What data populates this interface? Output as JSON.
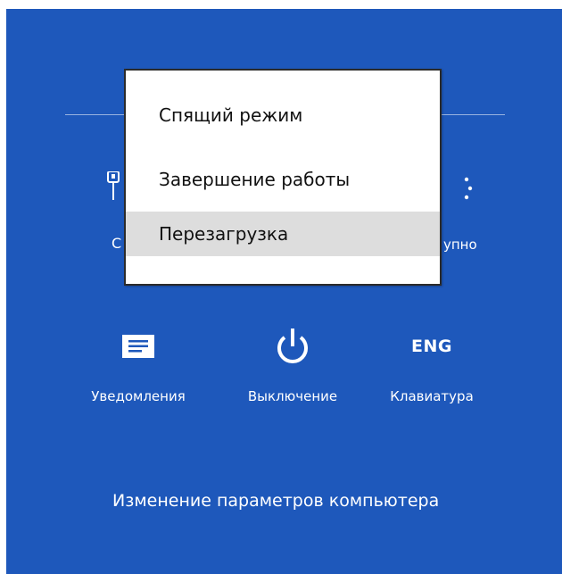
{
  "charms_panel": {
    "background_color": "#1e58bb",
    "hidden_left_label": "С",
    "hidden_left_icon": "network-icon",
    "hidden_right_label": "упно",
    "hidden_right_icon": "brightness-icon"
  },
  "power_menu": {
    "items": [
      {
        "label": "Спящий режим",
        "selected": false
      },
      {
        "label": "Завершение работы",
        "selected": false
      },
      {
        "label": "Перезагрузка",
        "selected": true
      }
    ],
    "selected_color": "#dddddd"
  },
  "tiles": [
    {
      "label": "Уведомления",
      "icon": "notifications-icon"
    },
    {
      "label": "Выключение",
      "icon": "power-icon"
    },
    {
      "label": "Клавиатура",
      "icon_text": "ENG"
    }
  ],
  "settings_link": {
    "label": "Изменение параметров компьютера"
  }
}
